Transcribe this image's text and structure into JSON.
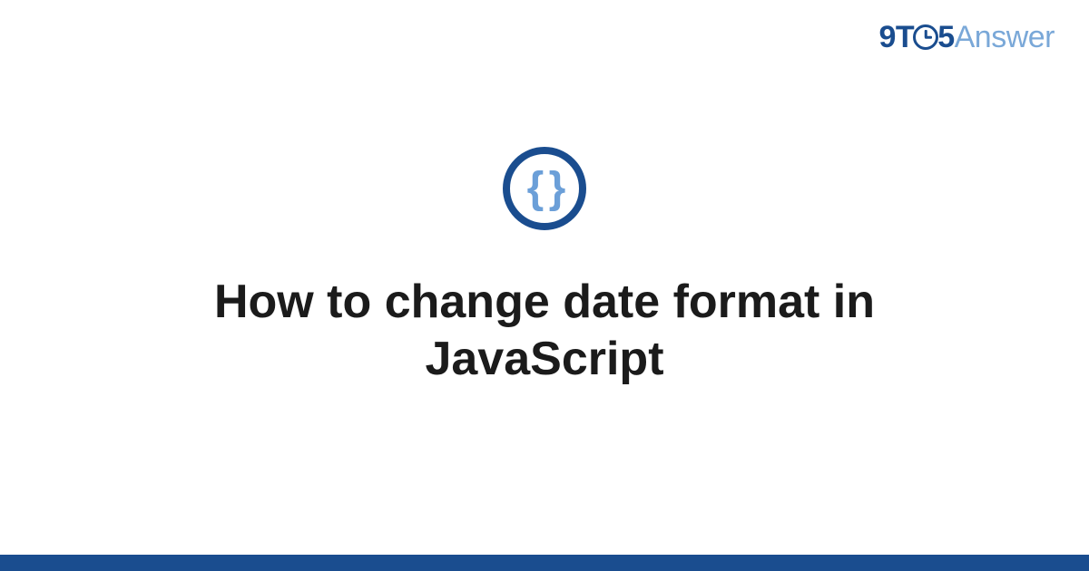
{
  "logo": {
    "part1": "9T",
    "part2": "5",
    "part3": "Answer"
  },
  "icon": {
    "glyph": "{ }",
    "name": "code-braces-icon"
  },
  "title": "How to change date format in JavaScript",
  "colors": {
    "brand_dark": "#1a4d8f",
    "brand_light": "#7aa8d8",
    "text": "#1b1b1b"
  }
}
